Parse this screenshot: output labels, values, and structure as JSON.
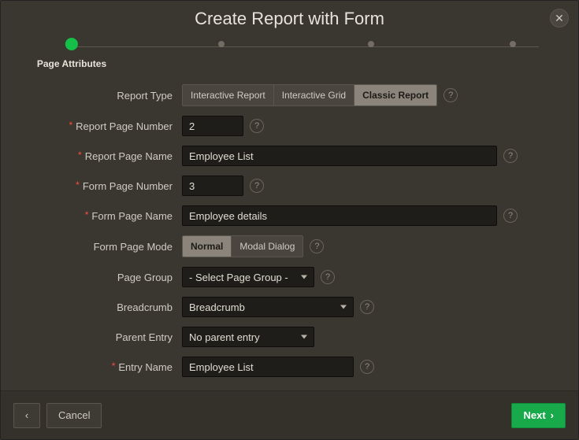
{
  "title": "Create Report with Form",
  "wizard": {
    "steps": [
      {
        "label": "Page Attributes",
        "active": true
      },
      {
        "label": "",
        "active": false
      },
      {
        "label": "",
        "active": false
      },
      {
        "label": "",
        "active": false
      }
    ]
  },
  "form": {
    "report_type": {
      "label": "Report Type",
      "options": [
        "Interactive Report",
        "Interactive Grid",
        "Classic Report"
      ],
      "selected_index": 2
    },
    "report_page_number": {
      "label": "Report Page Number",
      "value": "2",
      "required": true
    },
    "report_page_name": {
      "label": "Report Page Name",
      "value": "Employee List",
      "required": true
    },
    "form_page_number": {
      "label": "Form Page Number",
      "value": "3",
      "required": true
    },
    "form_page_name": {
      "label": "Form Page Name",
      "value": "Employee details",
      "required": true
    },
    "form_page_mode": {
      "label": "Form Page Mode",
      "options": [
        "Normal",
        "Modal Dialog"
      ],
      "selected_index": 0
    },
    "page_group": {
      "label": "Page Group",
      "value": "- Select Page Group -"
    },
    "breadcrumb": {
      "label": "Breadcrumb",
      "value": "Breadcrumb"
    },
    "parent_entry": {
      "label": "Parent Entry",
      "value": "No parent entry"
    },
    "entry_name": {
      "label": "Entry Name",
      "value": "Employee List",
      "required": true
    }
  },
  "footer": {
    "back_icon": "‹",
    "cancel": "Cancel",
    "next": "Next",
    "next_icon": "›"
  },
  "help_glyph": "?",
  "close_glyph": "✕"
}
